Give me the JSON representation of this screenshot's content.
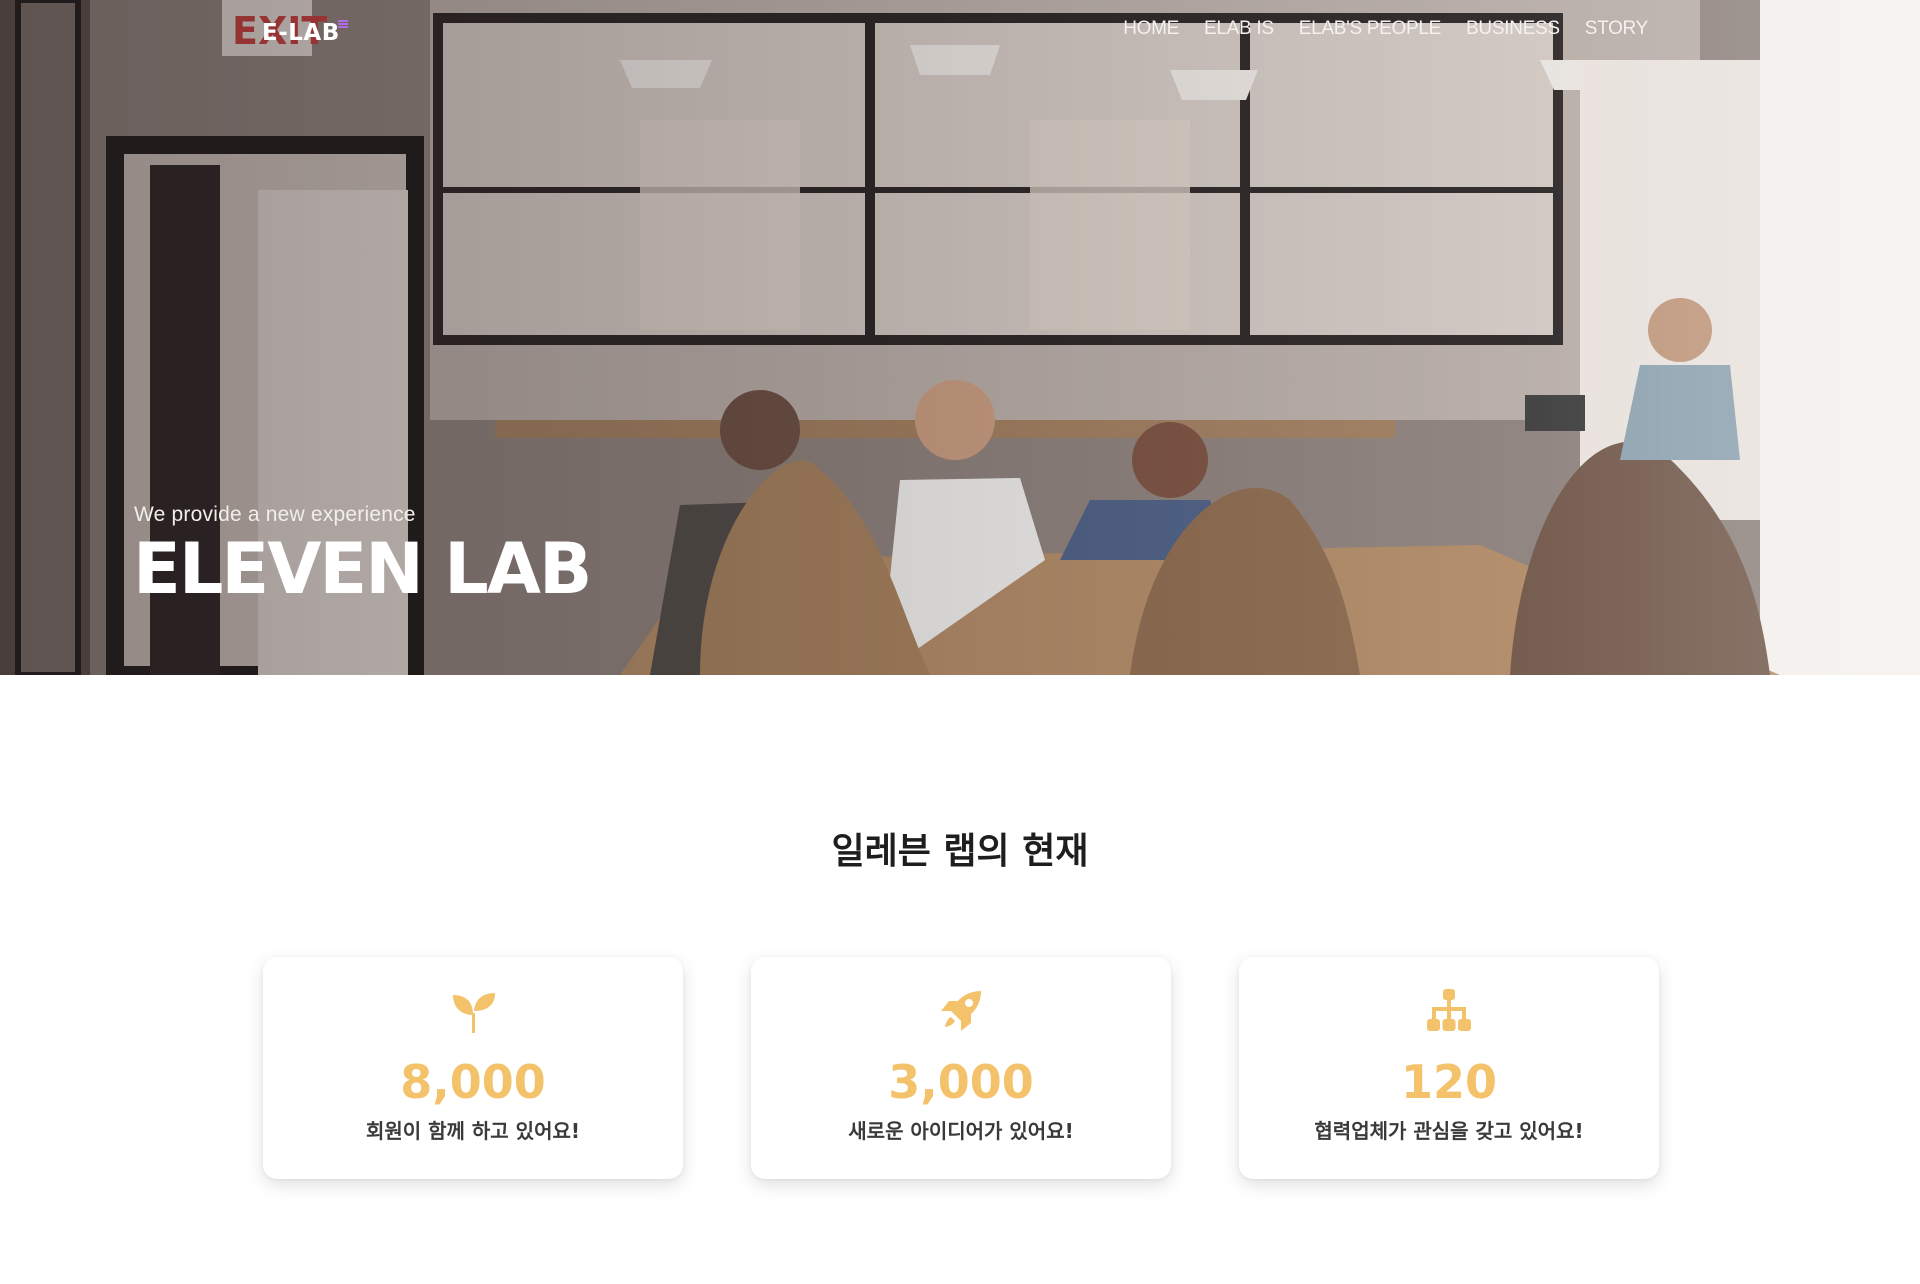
{
  "header": {
    "logo_text": "E-LAB",
    "nav": [
      {
        "label": "HOME"
      },
      {
        "label": "ELAB IS"
      },
      {
        "label": "ELAB'S PEOPLE"
      },
      {
        "label": "BUSINESS"
      },
      {
        "label": "STORY"
      }
    ]
  },
  "hero": {
    "tagline": "We provide a new experience",
    "title": "ELEVEN LAB"
  },
  "stats": {
    "title": "일레븐 랩의 현재",
    "accent_color": "#f3c26a",
    "cards": [
      {
        "icon": "seedling-icon",
        "value": "8,000",
        "label": "회원이 함께 하고 있어요!"
      },
      {
        "icon": "rocket-icon",
        "value": "3,000",
        "label": "새로운 아이디어가 있어요!"
      },
      {
        "icon": "sitemap-icon",
        "value": "120",
        "label": "협력업체가 관심을 갖고 있어요!"
      }
    ]
  }
}
